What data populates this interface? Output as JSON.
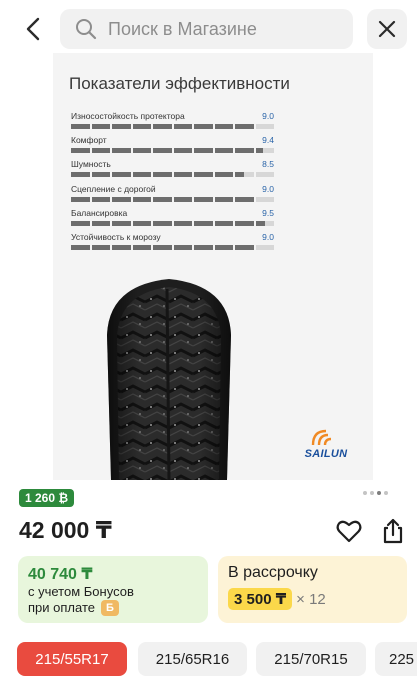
{
  "search": {
    "placeholder": "Поиск в Магазине"
  },
  "product_image": {
    "title": "Показатели эффективности",
    "brand": "SAILUN",
    "metrics": [
      {
        "label": "Износостойкость протектора",
        "value": "9.0",
        "score": 9.0
      },
      {
        "label": "Комфорт",
        "value": "9.4",
        "score": 9.4
      },
      {
        "label": "Шумность",
        "value": "8.5",
        "score": 8.5
      },
      {
        "label": "Сцепление с дорогой",
        "value": "9.0",
        "score": 9.0
      },
      {
        "label": "Балансировка",
        "value": "9.5",
        "score": 9.5
      },
      {
        "label": "Устойчивость к морозу",
        "value": "9.0",
        "score": 9.0
      }
    ],
    "gallery": {
      "total": 4,
      "active": 3
    }
  },
  "bonus_badge": "1 260 ₿",
  "price": "42 000 ₸",
  "offers": {
    "bonus": {
      "price": "40 740 ₸",
      "line1": "с учетом Бонусов",
      "line2": "при оплате",
      "icon_glyph": "Б"
    },
    "installment": {
      "title": "В рассрочку",
      "amount": "3 500 ₸",
      "multiplier": "× 12"
    }
  },
  "sizes": [
    {
      "label": "215/55R17",
      "selected": true
    },
    {
      "label": "215/65R16",
      "selected": false
    },
    {
      "label": "215/70R15",
      "selected": false
    },
    {
      "label": "225",
      "selected": false
    }
  ],
  "colors": {
    "accent_red": "#e94b3f",
    "bonus_green": "#2d8a3c",
    "install_yellow": "#fbd84a",
    "metric_value_blue": "#2a64a8"
  }
}
